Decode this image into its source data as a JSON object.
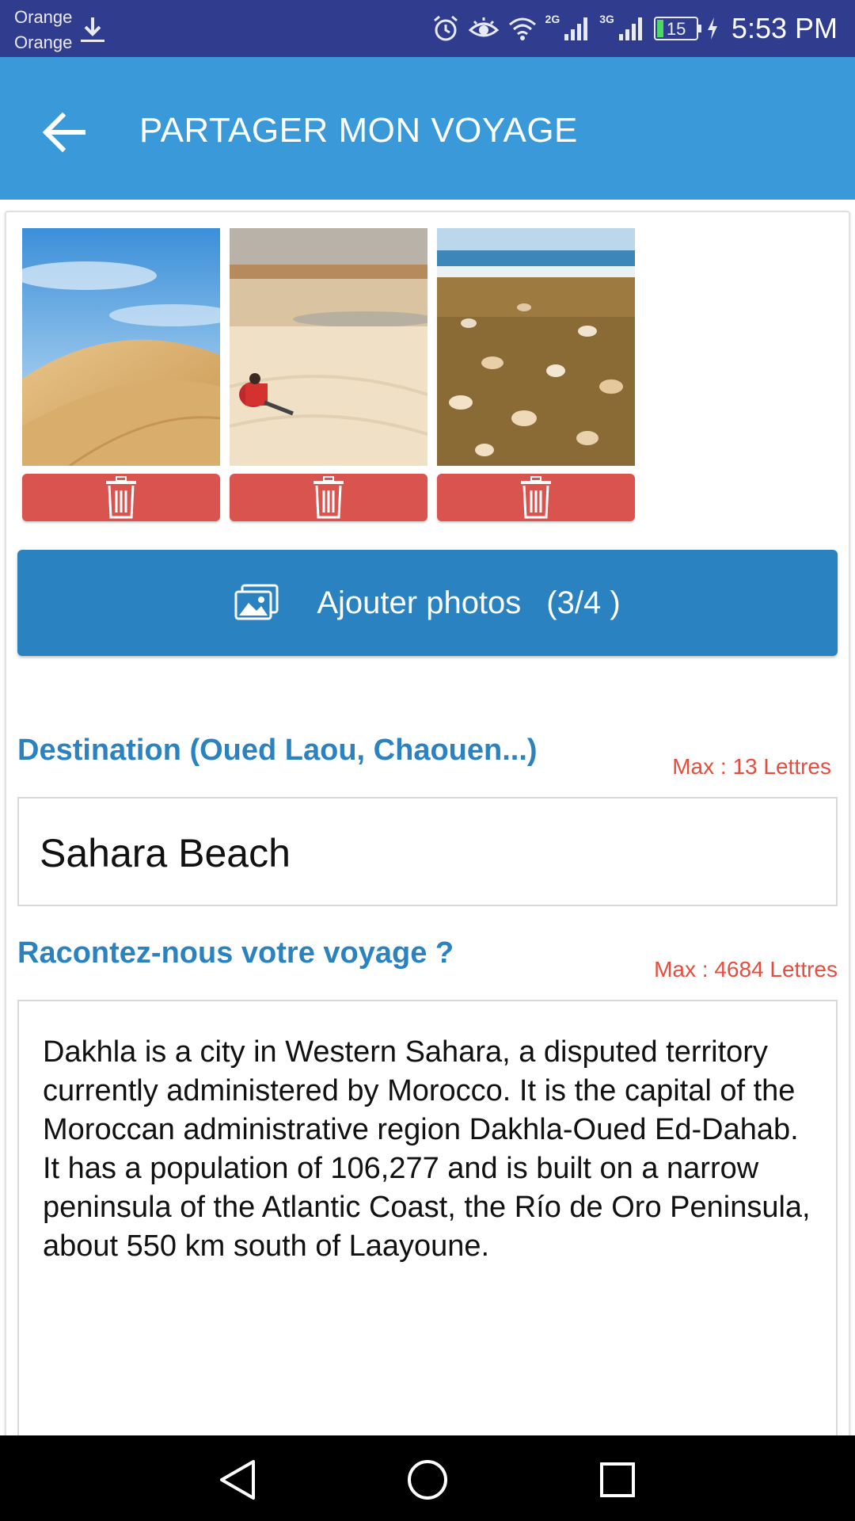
{
  "status_bar": {
    "carrier_1": "Orange",
    "carrier_2": "Orange",
    "network_1": "2G",
    "network_2": "3G",
    "battery": "15",
    "time": "5:53 PM",
    "icons": [
      "download-icon",
      "alarm-icon",
      "eye-icon",
      "wifi-icon",
      "signal-icon",
      "battery-icon",
      "charging-icon"
    ]
  },
  "app_bar": {
    "title": "PARTAGER MON VOYAGE",
    "back_icon": "arrow-left-icon",
    "background": "#3a9ad9"
  },
  "photos": [
    {
      "subject": "desert dunes under blue sky",
      "delete_icon": "trash-icon"
    },
    {
      "subject": "person sitting on white sand",
      "delete_icon": "trash-icon"
    },
    {
      "subject": "shells on beach sand",
      "delete_icon": "trash-icon"
    }
  ],
  "add_photos": {
    "label": "Ajouter photos",
    "count": "(3/4 )",
    "icon": "photos-icon",
    "background": "#2b82c1"
  },
  "destination": {
    "label": "Destination (Oued Laou, Chaouen...)",
    "max": "Max : 13 Lettres",
    "value": "Sahara Beach"
  },
  "story": {
    "label": "Racontez-nous votre voyage ?",
    "max": "Max : 4684 Lettres",
    "value": "Dakhla is a city in Western Sahara, a disputed territory currently administered by Morocco. It is the capital of the Moroccan administrative region Dakhla-Oued Ed-Dahab. It has a population of 106,277 and is built on a narrow peninsula of the Atlantic Coast, the Río de Oro Peninsula, about 550 km south of Laayoune."
  },
  "colors": {
    "status_bar": "#303c8e",
    "delete_button": "#d9534f",
    "label": "#2b82c1",
    "max_text": "#e74c3c"
  },
  "nav_bar": {
    "icons": [
      "back-triangle-icon",
      "home-circle-icon",
      "recents-square-icon"
    ]
  }
}
